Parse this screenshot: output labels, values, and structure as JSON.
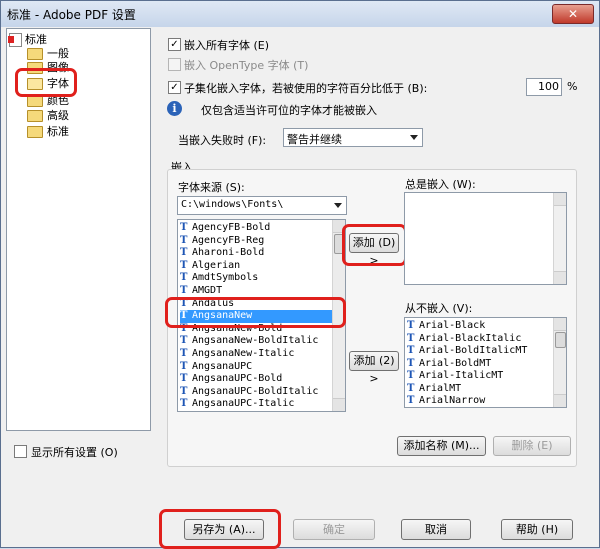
{
  "window": {
    "title": "标准 - Adobe PDF 设置",
    "close_label": "✕"
  },
  "tree": {
    "root": "标准",
    "items": [
      "一般",
      "图像",
      "字体",
      "颜色",
      "高级",
      "标准"
    ]
  },
  "options": {
    "embed_all": "嵌入所有字体 (E)",
    "embed_opentype": "嵌入 OpenType 字体 (T)",
    "subset": "子集化嵌入字体，若被使用的字符百分比低于 (B):",
    "subset_value": "100",
    "subset_unit": "%",
    "info_note": "仅包含适当许可位的字体才能被嵌入",
    "when_fail_label": "当嵌入失败时 (F):",
    "when_fail_value": "警告并继续"
  },
  "embed_group": {
    "title": "嵌入",
    "source_label": "字体来源 (S):",
    "source_value": "C:\\windows\\Fonts\\",
    "always_label": "总是嵌入 (W):",
    "never_label": "从不嵌入 (V):",
    "add1": "添加 (D) >",
    "add2": "添加 (2) >",
    "add_name": "添加名称 (M)...",
    "delete": "删除 (E)"
  },
  "source_fonts": [
    "AgencyFB-Bold",
    "AgencyFB-Reg",
    "Aharoni-Bold",
    "Algerian",
    "AmdtSymbols",
    "AMGDT",
    "Andalus",
    "AngsanaNew",
    "AngsanaNew-Bold",
    "AngsanaNew-BoldItalic",
    "AngsanaNew-Italic",
    "AngsanaUPC",
    "AngsanaUPC-Bold",
    "AngsanaUPC-BoldItalic",
    "AngsanaUPC-Italic"
  ],
  "never_fonts": [
    "Arial-Black",
    "Arial-BlackItalic",
    "Arial-BoldItalicMT",
    "Arial-BoldMT",
    "Arial-ItalicMT",
    "ArialMT",
    "ArialNarrow"
  ],
  "footer": {
    "show_all": "显示所有设置 (O)",
    "save_as": "另存为 (A)...",
    "ok": "确定",
    "cancel": "取消",
    "help": "帮助 (H)"
  }
}
